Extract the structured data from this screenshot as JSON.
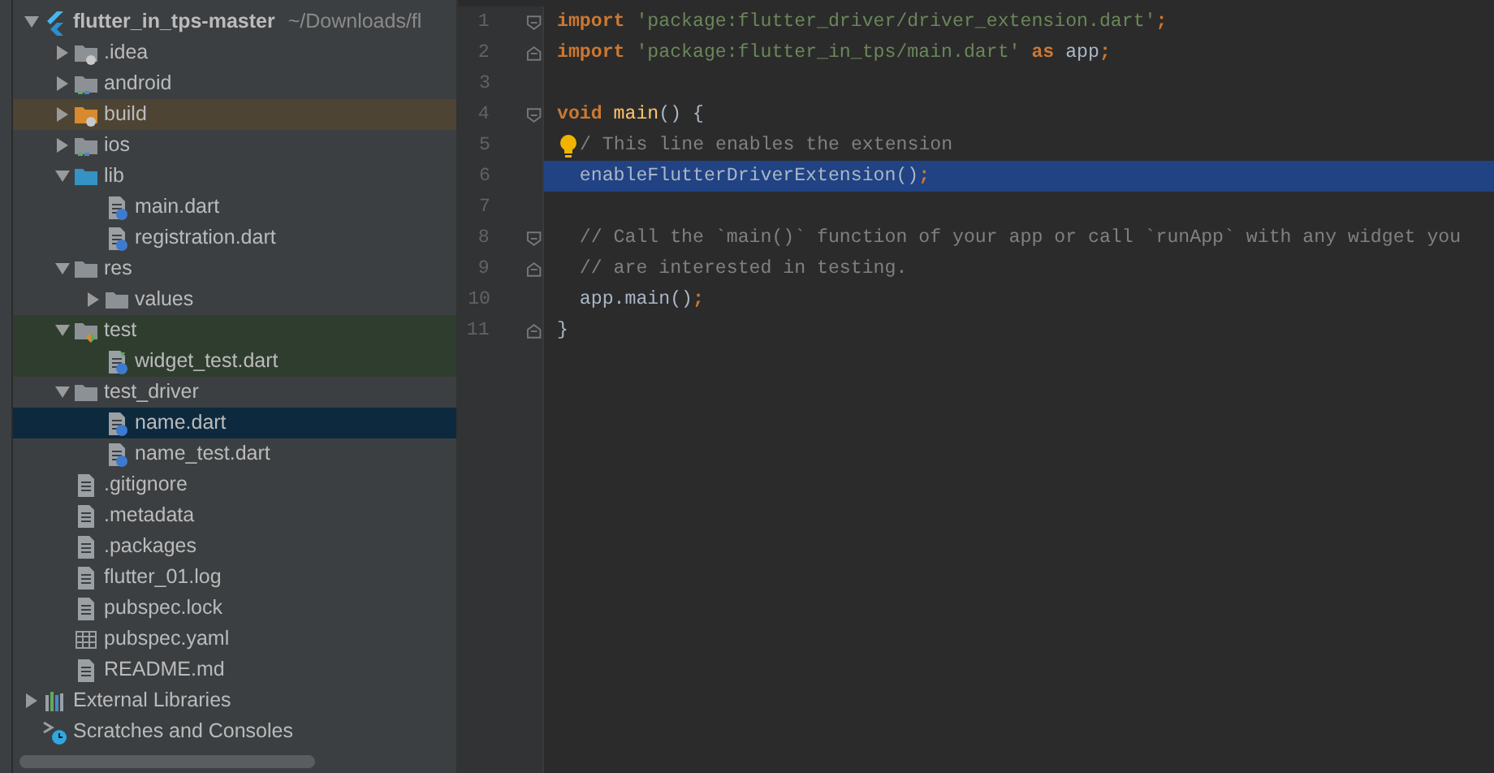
{
  "project_tree": [
    {
      "kind": "flutter-project",
      "label": "flutter_in_tps-master",
      "path": "~/Downloads/fl",
      "expanded": true,
      "selected": false,
      "children": [
        {
          "kind": "folder-config",
          "label": ".idea",
          "expanded": false,
          "selected": false
        },
        {
          "kind": "folder-module",
          "label": "android",
          "expanded": false,
          "selected": false
        },
        {
          "kind": "folder-excluded",
          "label": "build",
          "expanded": false,
          "selected": false,
          "color": "#4d4433"
        },
        {
          "kind": "folder-module",
          "label": "ios",
          "expanded": false,
          "selected": false
        },
        {
          "kind": "folder-source",
          "label": "lib",
          "expanded": true,
          "selected": false,
          "children": [
            {
              "kind": "dart",
              "label": "main.dart",
              "selected": false
            },
            {
              "kind": "dart",
              "label": "registration.dart",
              "selected": false
            }
          ]
        },
        {
          "kind": "folder",
          "label": "res",
          "expanded": true,
          "selected": false,
          "children": [
            {
              "kind": "folder",
              "label": "values",
              "expanded": false,
              "selected": false
            }
          ]
        },
        {
          "kind": "folder-test",
          "label": "test",
          "expanded": true,
          "selected": false,
          "color": "#2f3d2f",
          "children": [
            {
              "kind": "dart-test",
              "label": "widget_test.dart",
              "selected": false,
              "color": "#2f3d2f"
            }
          ]
        },
        {
          "kind": "folder",
          "label": "test_driver",
          "expanded": true,
          "selected": false,
          "children": [
            {
              "kind": "dart",
              "label": "name.dart",
              "selected": true
            },
            {
              "kind": "dart",
              "label": "name_test.dart",
              "selected": false
            }
          ]
        },
        {
          "kind": "text",
          "label": ".gitignore",
          "selected": false
        },
        {
          "kind": "text",
          "label": ".metadata",
          "selected": false
        },
        {
          "kind": "text",
          "label": ".packages",
          "selected": false
        },
        {
          "kind": "text",
          "label": "flutter_01.log",
          "selected": false
        },
        {
          "kind": "text",
          "label": "pubspec.lock",
          "selected": false
        },
        {
          "kind": "table",
          "label": "pubspec.yaml",
          "selected": false
        },
        {
          "kind": "text",
          "label": "README.md",
          "selected": false
        }
      ]
    },
    {
      "kind": "libraries",
      "label": "External Libraries",
      "expanded": false,
      "selected": false
    },
    {
      "kind": "scratches",
      "label": "Scratches and Consoles",
      "selected": false
    }
  ],
  "editor": {
    "lines": [
      {
        "number": "1",
        "fold_start": true,
        "selected": false,
        "tokens": [
          {
            "kind": "keyword",
            "text": "import "
          },
          {
            "kind": "string",
            "text": "'package:flutter_driver/driver_extension.dart'"
          },
          {
            "kind": "keyword",
            "text": ";"
          }
        ]
      },
      {
        "number": "2",
        "fold_end": true,
        "selected": false,
        "tokens": [
          {
            "kind": "keyword",
            "text": "import "
          },
          {
            "kind": "string",
            "text": "'package:flutter_in_tps/main.dart' "
          },
          {
            "kind": "keyword",
            "text": "as"
          },
          {
            "kind": "plain",
            "text": " app"
          },
          {
            "kind": "keyword",
            "text": ";"
          }
        ]
      },
      {
        "number": "3",
        "selected": false
      },
      {
        "number": "4",
        "fold_start": true,
        "selected": false,
        "tokens": [
          {
            "kind": "keyword",
            "text": "void "
          },
          {
            "kind": "function",
            "text": "main"
          },
          {
            "kind": "plain",
            "text": "() {"
          }
        ]
      },
      {
        "number": "5",
        "bulb": true,
        "selected": false,
        "tokens": [
          {
            "kind": "comment",
            "text": "/ This line enables the extension"
          }
        ]
      },
      {
        "number": "6",
        "selected": true,
        "tokens": [
          {
            "kind": "plain",
            "text": "  enableFlutterDriverExtension()"
          },
          {
            "kind": "keyword",
            "text": ";"
          }
        ]
      },
      {
        "number": "7",
        "selected": false
      },
      {
        "number": "8",
        "fold_start": true,
        "selected": false,
        "tokens": [
          {
            "kind": "comment",
            "text": "  // Call the `main()` function of your app or call `runApp` with any widget you"
          }
        ]
      },
      {
        "number": "9",
        "fold_end": true,
        "selected": false,
        "tokens": [
          {
            "kind": "comment",
            "text": "  // are interested in testing."
          }
        ]
      },
      {
        "number": "10",
        "selected": false,
        "tokens": [
          {
            "kind": "plain",
            "text": "  app.main()"
          },
          {
            "kind": "keyword",
            "text": ";"
          }
        ]
      },
      {
        "number": "11",
        "fold_end": true,
        "selected": false,
        "tokens": [
          {
            "kind": "plain",
            "text": "}"
          }
        ]
      }
    ]
  }
}
